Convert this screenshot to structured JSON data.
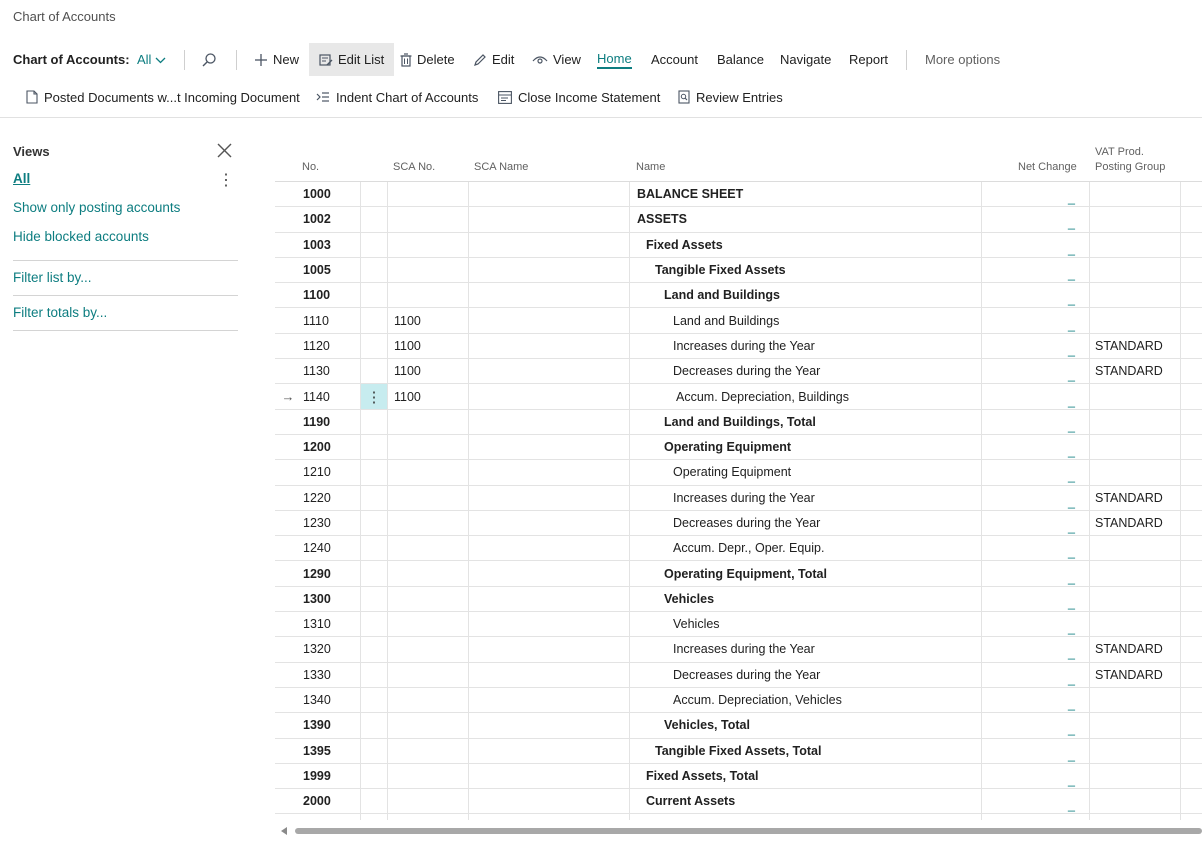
{
  "breadcrumb": "Chart of Accounts",
  "actionbar": {
    "page_title": "Chart of Accounts:",
    "view_selector": "All",
    "search_icon": "search-icon",
    "new_label": "New",
    "edit_list_label": "Edit List",
    "delete_label": "Delete",
    "edit_label": "Edit",
    "view_label": "View",
    "home_label": "Home",
    "account_label": "Account",
    "balance_label": "Balance",
    "navigate_label": "Navigate",
    "report_label": "Report",
    "more_options_label": "More options"
  },
  "promoted": {
    "posted_docs": "Posted Documents w...t Incoming Document",
    "indent": "Indent Chart of Accounts",
    "close_income": "Close Income Statement",
    "review": "Review Entries"
  },
  "views": {
    "title": "Views",
    "items": [
      "All",
      "Show only posting accounts",
      "Hide blocked accounts"
    ],
    "filter_list": "Filter list by...",
    "filter_totals": "Filter totals by..."
  },
  "grid": {
    "headers": {
      "no": "No.",
      "sca_no": "SCA No.",
      "sca_name": "SCA Name",
      "name": "Name",
      "net_change": "Net Change",
      "vat_line1": "VAT Prod.",
      "vat_line2": "Posting Group"
    },
    "rows": [
      {
        "no": "1000",
        "sca": "",
        "name": "BALANCE SHEET",
        "indent": 0,
        "bold": true,
        "net": "_",
        "vat": "",
        "selected": false
      },
      {
        "no": "1002",
        "sca": "",
        "name": "ASSETS",
        "indent": 0,
        "bold": true,
        "net": "_",
        "vat": "",
        "selected": false
      },
      {
        "no": "1003",
        "sca": "",
        "name": "Fixed Assets",
        "indent": 1,
        "bold": true,
        "net": "_",
        "vat": "",
        "selected": false
      },
      {
        "no": "1005",
        "sca": "",
        "name": "Tangible Fixed Assets",
        "indent": 2,
        "bold": true,
        "net": "_",
        "vat": "",
        "selected": false
      },
      {
        "no": "1100",
        "sca": "",
        "name": "Land and Buildings",
        "indent": 3,
        "bold": true,
        "net": "_",
        "vat": "",
        "selected": false
      },
      {
        "no": "1110",
        "sca": "1100",
        "name": "Land and Buildings",
        "indent": 4,
        "bold": false,
        "net": "_",
        "vat": "",
        "selected": false
      },
      {
        "no": "1120",
        "sca": "1100",
        "name": "Increases during the Year",
        "indent": 4,
        "bold": false,
        "net": "_",
        "vat": "STANDARD",
        "selected": false
      },
      {
        "no": "1130",
        "sca": "1100",
        "name": "Decreases during the Year",
        "indent": 4,
        "bold": false,
        "net": "_",
        "vat": "STANDARD",
        "selected": false
      },
      {
        "no": "1140",
        "sca": "1100",
        "name": "Accum. Depreciation, Buildings",
        "indent": 4,
        "bold": false,
        "net": "_",
        "vat": "",
        "selected": true
      },
      {
        "no": "1190",
        "sca": "",
        "name": "Land and Buildings, Total",
        "indent": 3,
        "bold": true,
        "net": "_",
        "vat": "",
        "selected": false
      },
      {
        "no": "1200",
        "sca": "",
        "name": "Operating Equipment",
        "indent": 3,
        "bold": true,
        "net": "_",
        "vat": "",
        "selected": false
      },
      {
        "no": "1210",
        "sca": "",
        "name": "Operating Equipment",
        "indent": 4,
        "bold": false,
        "net": "_",
        "vat": "",
        "selected": false
      },
      {
        "no": "1220",
        "sca": "",
        "name": "Increases during the Year",
        "indent": 4,
        "bold": false,
        "net": "_",
        "vat": "STANDARD",
        "selected": false
      },
      {
        "no": "1230",
        "sca": "",
        "name": "Decreases during the Year",
        "indent": 4,
        "bold": false,
        "net": "_",
        "vat": "STANDARD",
        "selected": false
      },
      {
        "no": "1240",
        "sca": "",
        "name": "Accum. Depr., Oper. Equip.",
        "indent": 4,
        "bold": false,
        "net": "_",
        "vat": "",
        "selected": false
      },
      {
        "no": "1290",
        "sca": "",
        "name": "Operating Equipment, Total",
        "indent": 3,
        "bold": true,
        "net": "_",
        "vat": "",
        "selected": false
      },
      {
        "no": "1300",
        "sca": "",
        "name": "Vehicles",
        "indent": 3,
        "bold": true,
        "net": "_",
        "vat": "",
        "selected": false
      },
      {
        "no": "1310",
        "sca": "",
        "name": "Vehicles",
        "indent": 4,
        "bold": false,
        "net": "_",
        "vat": "",
        "selected": false
      },
      {
        "no": "1320",
        "sca": "",
        "name": "Increases during the Year",
        "indent": 4,
        "bold": false,
        "net": "_",
        "vat": "STANDARD",
        "selected": false
      },
      {
        "no": "1330",
        "sca": "",
        "name": "Decreases during the Year",
        "indent": 4,
        "bold": false,
        "net": "_",
        "vat": "STANDARD",
        "selected": false
      },
      {
        "no": "1340",
        "sca": "",
        "name": "Accum. Depreciation, Vehicles",
        "indent": 4,
        "bold": false,
        "net": "_",
        "vat": "",
        "selected": false
      },
      {
        "no": "1390",
        "sca": "",
        "name": "Vehicles, Total",
        "indent": 3,
        "bold": true,
        "net": "_",
        "vat": "",
        "selected": false
      },
      {
        "no": "1395",
        "sca": "",
        "name": "Tangible Fixed Assets, Total",
        "indent": 2,
        "bold": true,
        "net": "_",
        "vat": "",
        "selected": false
      },
      {
        "no": "1999",
        "sca": "",
        "name": "Fixed Assets, Total",
        "indent": 1,
        "bold": true,
        "net": "_",
        "vat": "",
        "selected": false
      },
      {
        "no": "2000",
        "sca": "",
        "name": "Current Assets",
        "indent": 1,
        "bold": true,
        "net": "_",
        "vat": "",
        "selected": false
      }
    ]
  },
  "colors": {
    "accent": "#0d7d80",
    "selected_cell": "#c7ecef",
    "toolbar_selected": "#e8e8e8"
  }
}
